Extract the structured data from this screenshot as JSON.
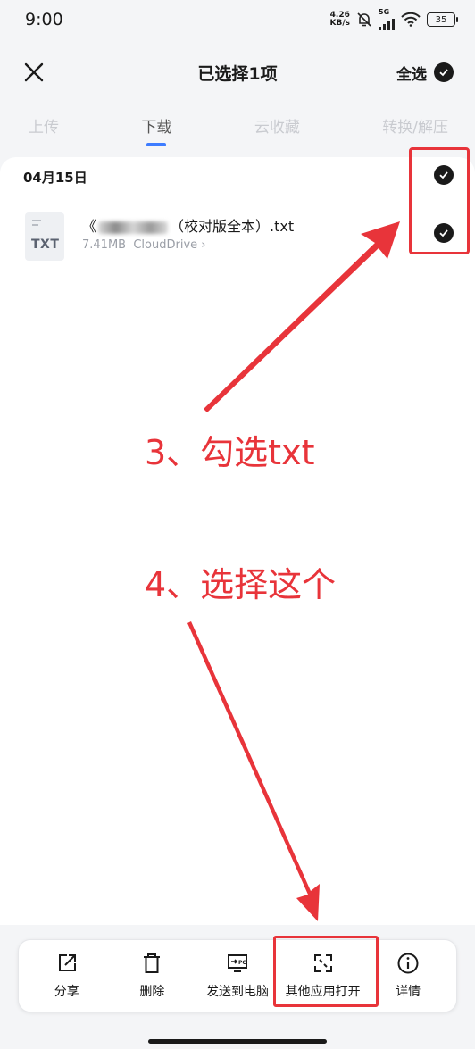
{
  "status": {
    "time": "9:00",
    "net_speed_value": "4.26",
    "net_speed_unit": "KB/s",
    "network": "5G",
    "battery": "35"
  },
  "header": {
    "title": "已选择1项",
    "select_all_label": "全选"
  },
  "tabs": [
    {
      "label": "上传",
      "active": false
    },
    {
      "label": "下载",
      "active": true
    },
    {
      "label": "云收藏",
      "active": false
    },
    {
      "label": "转换/解压",
      "active": false
    }
  ],
  "list": {
    "date_label": "04月15日",
    "file": {
      "icon_type": "TXT",
      "name_prefix": "《",
      "name_suffix": "（校对版全本）.txt",
      "size": "7.41MB",
      "source": "CloudDrive",
      "source_chevron": "›"
    }
  },
  "annotations": {
    "step3": "3、勾选txt",
    "step4": "4、选择这个"
  },
  "toolbar": [
    {
      "label": "分享",
      "icon": "share-icon"
    },
    {
      "label": "删除",
      "icon": "trash-icon"
    },
    {
      "label": "发送到电脑",
      "icon": "send-to-pc-icon"
    },
    {
      "label": "其他应用打开",
      "icon": "open-with-icon"
    },
    {
      "label": "详情",
      "icon": "info-icon"
    }
  ],
  "colors": {
    "accent_blue": "#3d7cff",
    "annotation_red": "#e8343a",
    "background": "#f4f5f7"
  }
}
